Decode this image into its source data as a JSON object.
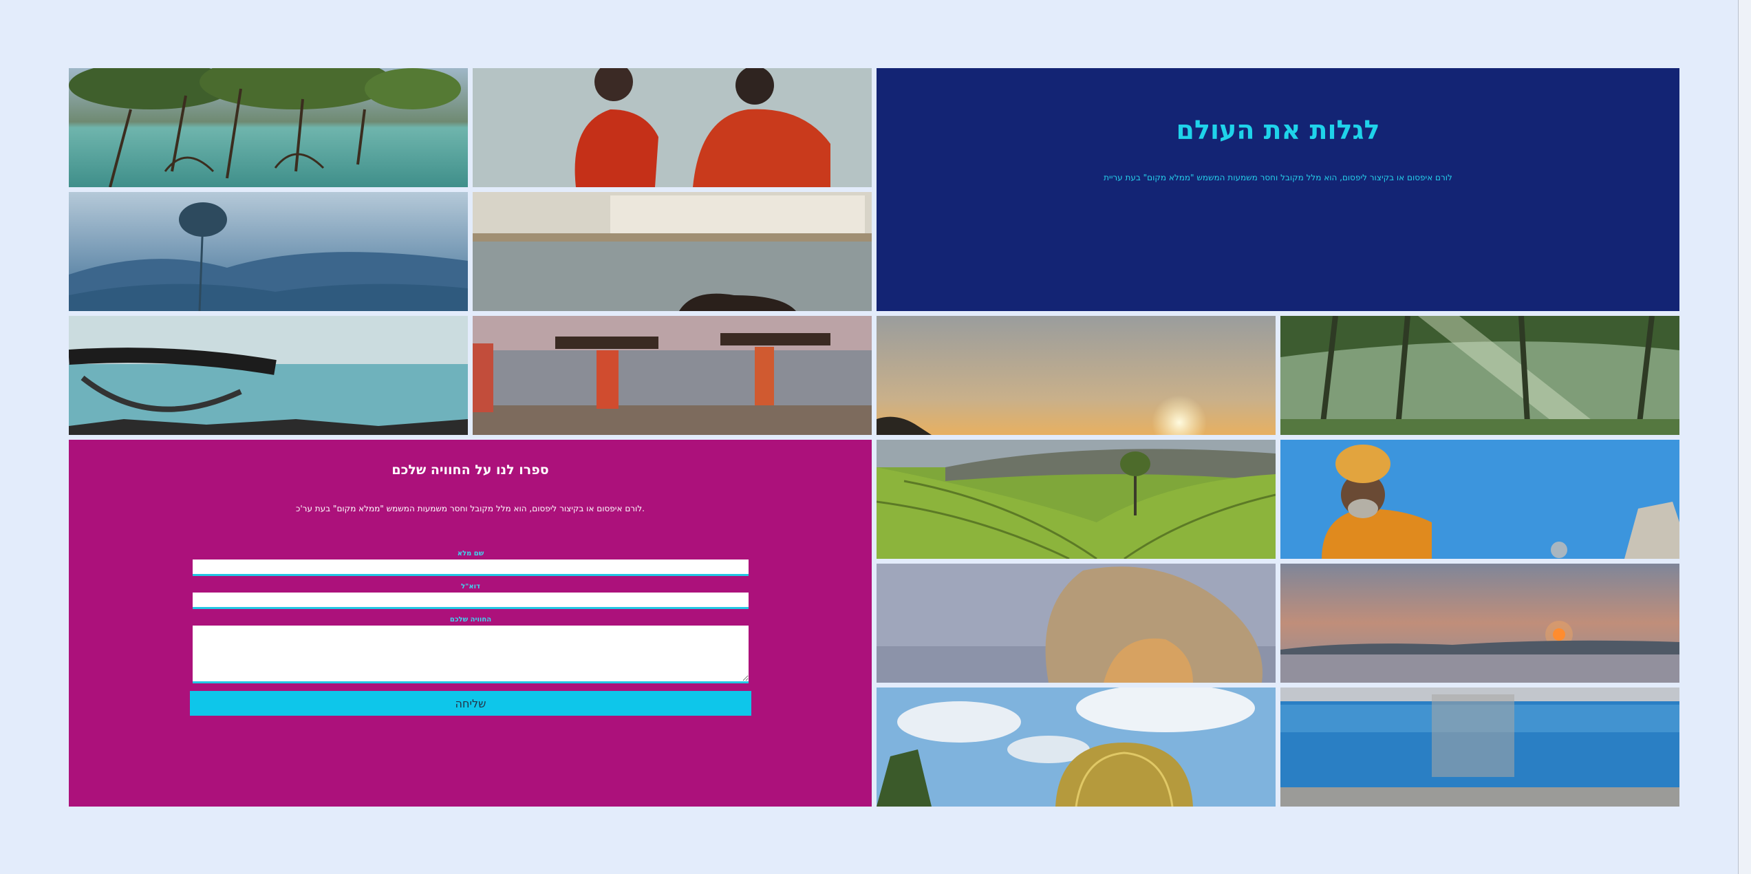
{
  "intro": {
    "title": "לגלות את העולם",
    "text": "לורם איפסום או בקיצור ליפסום, הוא מלל מקובל וחסר משמעות המשמש \"ממלא מקום\" בעת עריית"
  },
  "feedback": {
    "title": "ספרו לנו על החוויה שלכם",
    "text": "לורם איפסום או בקיצור ליפסום, הוא מלל מקובל וחסר משמעות המשמש \"ממלא מקום\" בעת ער'כ.",
    "name_label": "שם מלא",
    "email_label": "דוא\"ל",
    "experience_label": "החוויה שלכם",
    "name_value": "",
    "email_value": "",
    "experience_value": "",
    "submit_label": "שליחה"
  },
  "colors": {
    "background": "#e3ecfb",
    "intro_bg": "#132474",
    "accent": "#1fd3ea",
    "form_bg": "#ac117b",
    "button": "#0ec6ea"
  },
  "gallery": [
    {
      "name": "mangroves-photo"
    },
    {
      "name": "women-red-saris-photo"
    },
    {
      "name": "misty-mountains-photo"
    },
    {
      "name": "lakeside-town-photo"
    },
    {
      "name": "hammock-beach-photo"
    },
    {
      "name": "women-carrying-wood-photo"
    },
    {
      "name": "sunset-sky-photo"
    },
    {
      "name": "palm-forest-photo"
    },
    {
      "name": "tea-plantation-photo"
    },
    {
      "name": "sadhu-blue-wall-photo"
    },
    {
      "name": "monkey-photo"
    },
    {
      "name": "sunset-sea-photo"
    },
    {
      "name": "golden-dome-photo"
    },
    {
      "name": "blue-train-photo"
    }
  ]
}
